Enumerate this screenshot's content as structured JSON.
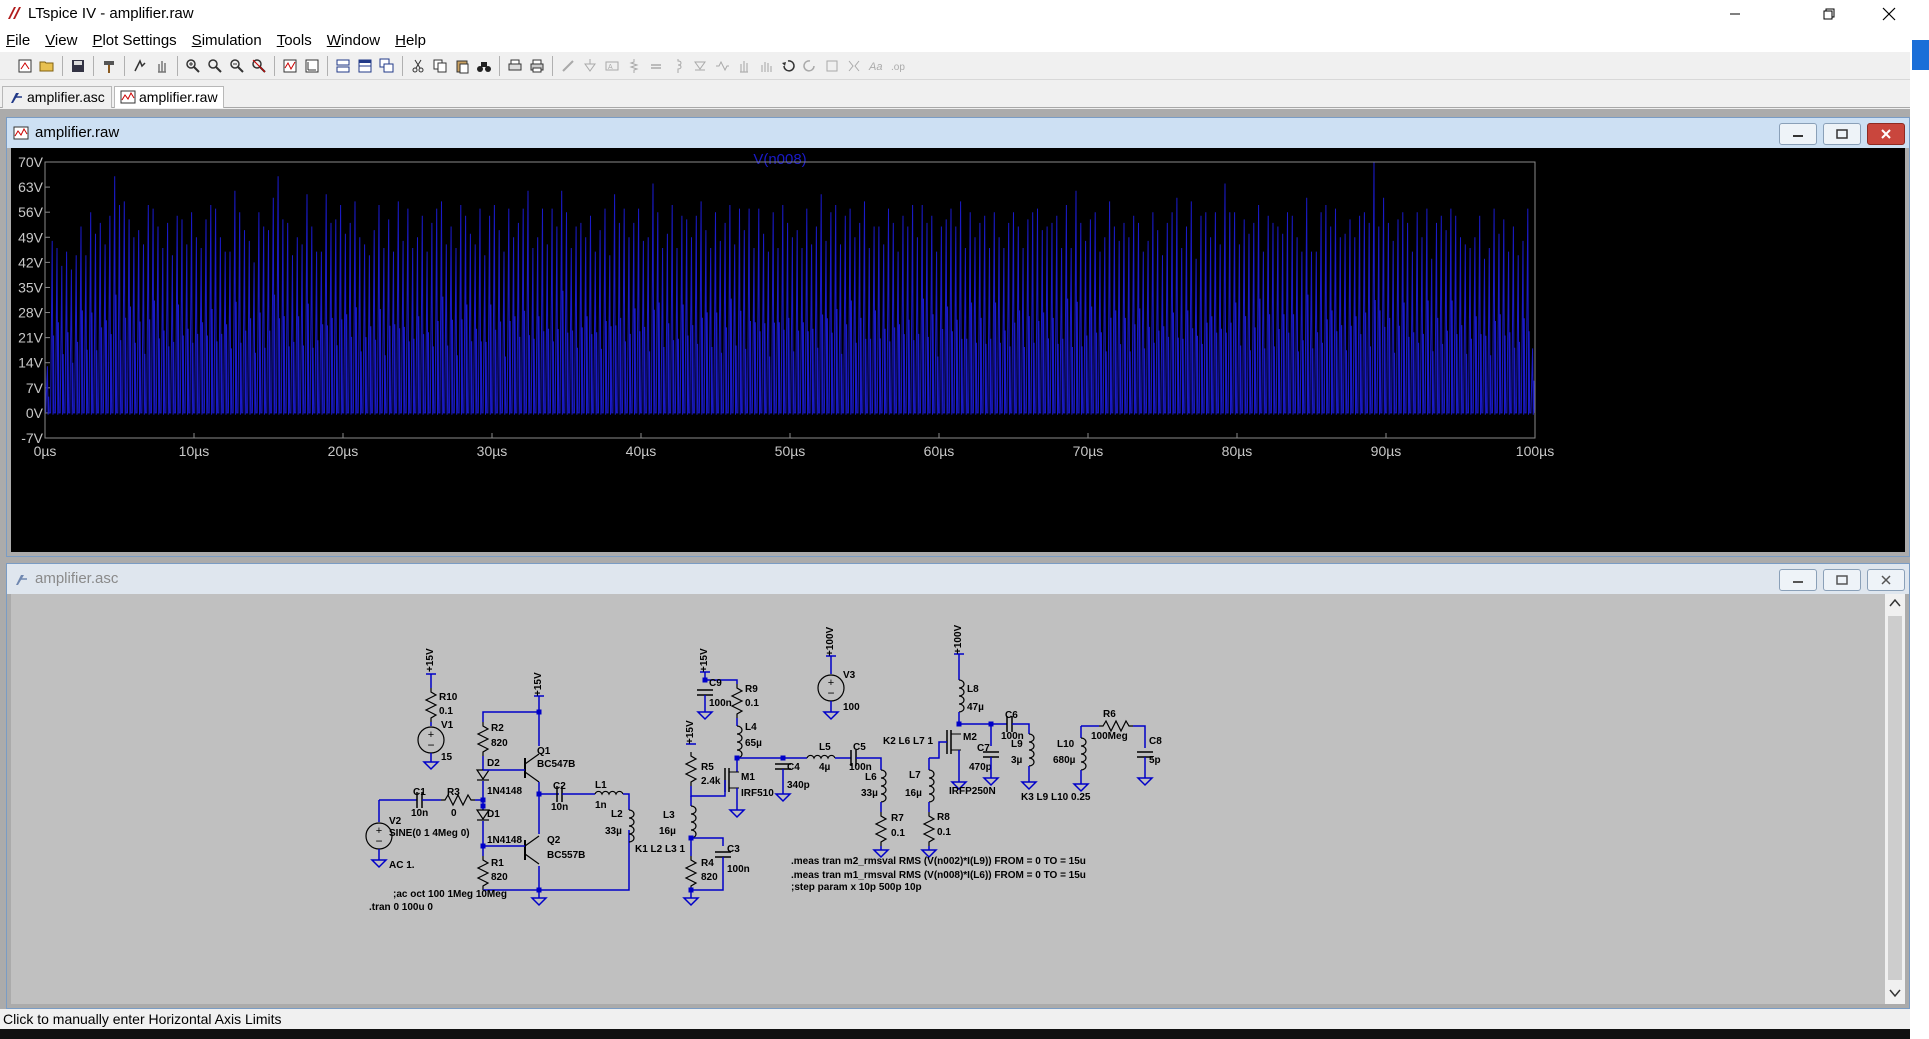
{
  "window": {
    "title": "LTspice IV - amplifier.raw",
    "minimize": "—",
    "maximize": "❐",
    "close": "✕"
  },
  "menu": [
    {
      "label": "File",
      "u": "F",
      "rest": "ile"
    },
    {
      "label": "View",
      "u": "V",
      "rest": "iew"
    },
    {
      "label": "Plot Settings",
      "u": "P",
      "rest": "lot Settings"
    },
    {
      "label": "Simulation",
      "u": "S",
      "rest": "imulation"
    },
    {
      "label": "Tools",
      "u": "T",
      "rest": "ools"
    },
    {
      "label": "Window",
      "u": "W",
      "rest": "indow"
    },
    {
      "label": "Help",
      "u": "H",
      "rest": "elp"
    }
  ],
  "tabs": [
    {
      "label": "amplifier.asc",
      "active": false
    },
    {
      "label": "amplifier.raw",
      "active": true
    }
  ],
  "waveform_window": {
    "title": "amplifier.raw"
  },
  "schematic_window": {
    "title": "amplifier.asc"
  },
  "status": {
    "text": "Click to manually enter Horizontal Axis Limits"
  },
  "chart_data": {
    "type": "line",
    "title": "V(n008)",
    "xlabel": "",
    "ylabel": "",
    "x_ticks": [
      "0µs",
      "10µs",
      "20µs",
      "30µs",
      "40µs",
      "50µs",
      "60µs",
      "70µs",
      "80µs",
      "90µs",
      "100µs"
    ],
    "y_ticks": [
      "70V",
      "63V",
      "56V",
      "49V",
      "42V",
      "35V",
      "28V",
      "21V",
      "14V",
      "7V",
      "0V",
      "-7V"
    ],
    "xlim": [
      0,
      100
    ],
    "ylim": [
      -7,
      70
    ],
    "x_unit": "µs",
    "y_unit": "V",
    "series": [
      {
        "color": "#1a1ac8",
        "peaks": [
          13,
          48,
          46,
          41,
          45,
          40,
          44,
          52,
          44,
          56,
          50,
          53,
          47,
          55,
          66,
          58,
          59,
          54,
          49,
          51,
          47,
          58,
          57,
          52,
          46,
          53,
          44,
          55,
          54,
          47,
          56,
          49,
          46,
          54,
          58,
          57,
          49,
          45,
          45,
          62,
          56,
          51,
          48,
          42,
          56,
          52,
          51,
          60,
          66,
          54,
          53,
          44,
          49,
          47,
          61,
          52,
          45,
          45,
          61,
          53,
          54,
          58,
          50,
          53,
          59,
          49,
          47,
          44,
          51,
          58,
          46,
          54,
          45,
          59,
          48,
          57,
          46,
          49,
          55,
          45,
          53,
          57,
          59,
          47,
          52,
          46,
          58,
          55,
          50,
          47,
          57,
          44,
          55,
          58,
          51,
          45,
          57,
          49,
          53,
          57,
          62,
          46,
          49,
          57,
          47,
          57,
          52,
          62,
          56,
          46,
          52,
          53,
          49,
          55,
          45,
          51,
          57,
          44,
          61,
          53,
          57,
          49,
          53,
          57,
          48,
          49,
          64,
          56,
          46,
          50,
          58,
          46,
          55,
          54,
          49,
          55,
          59,
          51,
          46,
          56,
          48,
          53,
          58,
          47,
          57,
          51,
          57,
          46,
          57,
          50,
          45,
          56,
          46,
          58,
          53,
          49,
          51,
          46,
          57,
          47,
          52,
          61,
          48,
          56,
          58,
          47,
          55,
          57,
          49,
          53,
          59,
          46,
          52,
          52,
          47,
          57,
          53,
          45,
          55,
          52,
          58,
          49,
          58,
          53,
          55,
          45,
          52,
          54,
          57,
          52,
          59,
          46,
          56,
          49,
          53,
          55,
          46,
          56,
          49,
          46,
          53,
          56,
          52,
          46,
          54,
          56,
          57,
          51,
          52,
          53,
          55,
          46,
          58,
          46,
          62,
          53,
          48,
          54,
          56,
          45,
          49,
          59,
          52,
          48,
          53,
          49,
          55,
          53,
          45,
          48,
          56,
          51,
          44,
          53,
          56,
          60,
          46,
          52,
          59,
          43,
          55,
          56,
          49,
          56,
          47,
          64,
          56,
          56,
          47,
          54,
          50,
          53,
          58,
          45,
          55,
          53,
          52,
          50,
          56,
          55,
          49,
          45,
          60,
          45,
          45,
          56,
          58,
          52,
          57,
          49,
          50,
          54,
          49,
          55,
          56,
          53,
          70,
          52,
          60,
          53,
          48,
          54,
          56,
          53,
          45,
          56,
          49,
          57,
          43,
          53,
          55,
          51,
          57,
          55,
          49,
          47,
          46,
          49,
          55,
          43,
          46,
          57,
          50,
          54,
          45,
          52,
          44,
          48,
          57,
          18
        ]
      }
    ]
  },
  "schematic": {
    "labels": {
      "p15a": "+15V",
      "p15b": "+15V",
      "p15c": "+15V",
      "p15d": "+15V",
      "p100a": "+100V",
      "p100b": "+100V",
      "R10": "R10",
      "R10v": "0.1",
      "V1": "V1",
      "V1v": "15",
      "R2": "R2",
      "R2v": "820",
      "Q1": "Q1",
      "Q1v": "BC547B",
      "D2": "D2",
      "D2v": "1N4148",
      "D1": "D1",
      "D1v": "1N4148",
      "C1": "C1",
      "C1v": "10n",
      "R3": "R3",
      "R3v": "0",
      "V2": "V2",
      "V2v": "SINE(0 1 4Meg 0)",
      "V2ac": "AC 1.",
      "C2": "C2",
      "C2v": "10n",
      "L1": "L1",
      "L1v": "1n",
      "L2": "L2",
      "L2v": "33µ",
      "Q2": "Q2",
      "Q2v": "BC557B",
      "R1": "R1",
      "R1v": "820",
      "K1": "K1 L2 L3 1",
      "ac": ";ac oct 100 1Meg 10Meg",
      "tran": ".tran 0 100u 0",
      "C9": "C9",
      "C9v": "100n",
      "R9": "R9",
      "R9v": "0.1",
      "L4": "L4",
      "L4v": "65µ",
      "R5": "R5",
      "R5v": "2.4k",
      "M1": "M1",
      "M1v": "IRF510",
      "C4": "C4",
      "C4v": "340p",
      "L3": "L3",
      "L3v": "16µ",
      "R4": "R4",
      "R4v": "820",
      "C3": "C3",
      "C3v": "100n",
      "V3": "V3",
      "V3v": "100",
      "L5": "L5",
      "L5v": "4µ",
      "C5": "C5",
      "C5v": "100n",
      "L6": "L6",
      "L6v": "33µ",
      "R7": "R7",
      "R7v": "0.1",
      "K2": "K2 L6 L7 1",
      "L7": "L7",
      "L7v": "16µ",
      "R8": "R8",
      "R8v": "0.1",
      "L8": "L8",
      "L8v": "47µ",
      "M2": "M2",
      "M2v": "IRFP250N",
      "C7": "C7",
      "C7v": "470p",
      "C6": "C6",
      "C6v": "100n",
      "L9": "L9",
      "L9v": "3µ",
      "K3": "K3 L9 L10 0.25",
      "L10": "L10",
      "L10v": "680µ",
      "R6": "R6",
      "R6v": "100Meg",
      "C8": "C8",
      "C8v": "5p",
      "meas1": ".meas tran m2_rmsval RMS (V(n002)*I(L9)) FROM = 0 TO = 15u",
      "meas2": ".meas tran m1_rmsval RMS (V(n008)*I(L6)) FROM = 0 TO = 15u",
      "step": ";step param x 10p 500p 10p"
    }
  },
  "colors": {
    "wire": "#0000c8",
    "trace": "#1a1ac8",
    "plot_bg": "#000000",
    "schematic_bg": "#c0c0c0"
  }
}
